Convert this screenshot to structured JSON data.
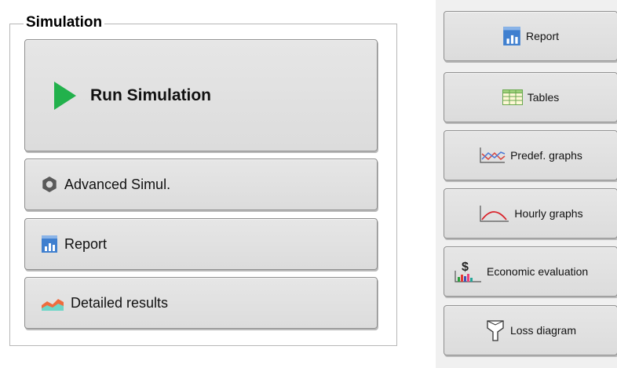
{
  "simulation_group": {
    "title": "Simulation",
    "run_label": "Run Simulation",
    "advanced_label": "Advanced Simul.",
    "report_label": "Report",
    "detailed_label": "Detailed results"
  },
  "results_panel": {
    "report_label": "Report",
    "tables_label": "Tables",
    "predef_graphs_label": "Predef. graphs",
    "hourly_graphs_label": "Hourly graphs",
    "economic_label": "Economic evaluation",
    "loss_diagram_label": "Loss diagram"
  },
  "icons": {
    "run": "play-icon",
    "advanced": "gear-icon",
    "report": "report-chart-icon",
    "detailed": "area-chart-icon",
    "tables": "table-icon",
    "predef_graphs": "line-graph-icon",
    "hourly_graphs": "hourly-curve-icon",
    "economic": "dollar-chart-icon",
    "loss": "loss-diagram-icon"
  },
  "colors": {
    "play_green": "#22b14c",
    "report_blue": "#3f7fcf",
    "button_face": "#e0e0e0",
    "panel_bg": "#f0f0f0"
  }
}
